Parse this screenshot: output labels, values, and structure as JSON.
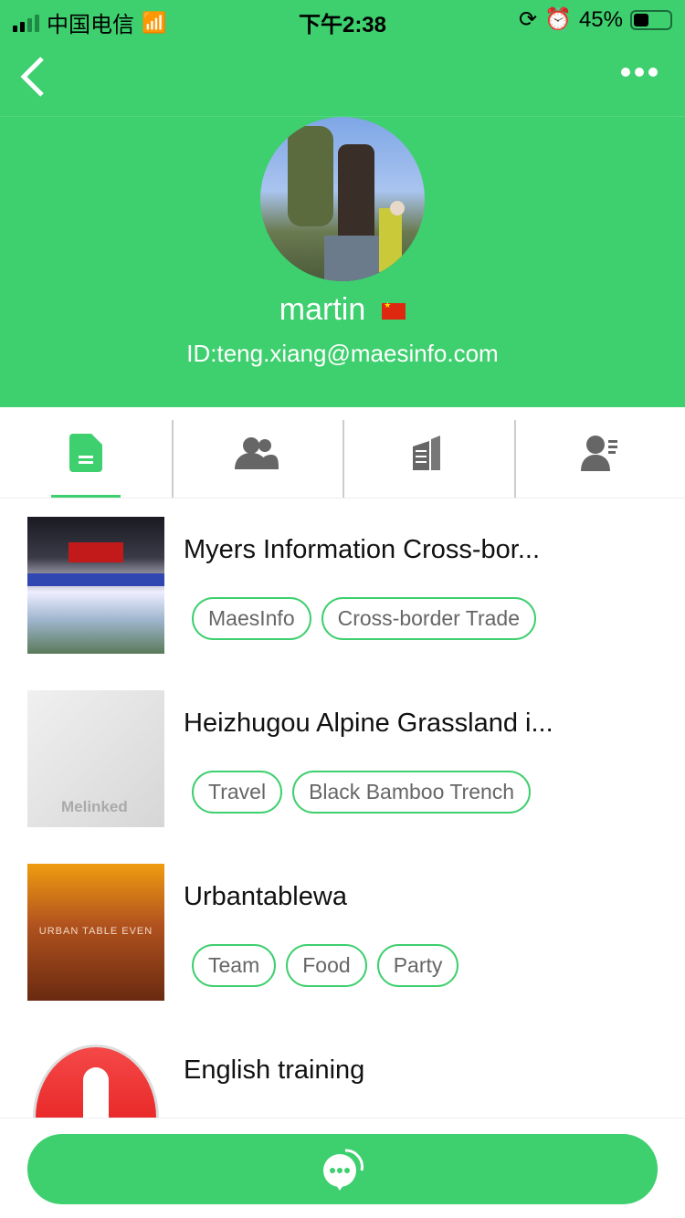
{
  "status_bar": {
    "carrier": "中国电信",
    "time": "下午2:38",
    "battery": "45%"
  },
  "profile": {
    "name": "martin",
    "id": "ID:teng.xiang@maesinfo.com",
    "country_flag": "china-flag"
  },
  "tabs": [
    {
      "icon": "document-icon",
      "active": true
    },
    {
      "icon": "contacts-icon"
    },
    {
      "icon": "building-icon"
    },
    {
      "icon": "user-card-icon"
    }
  ],
  "items": [
    {
      "title": "Myers Information Cross-bor...",
      "tags": [
        "MaesInfo",
        "Cross-border Trade"
      ]
    },
    {
      "title": "Heizhugou Alpine Grassland i...",
      "tags": [
        "Travel",
        "Black Bamboo Trench"
      ],
      "thumb_text": "Melinked"
    },
    {
      "title": "Urbantablewa",
      "tags": [
        "Team",
        "Food",
        "Party"
      ],
      "thumb_text": "URBAN TABLE EVEN"
    },
    {
      "title": "English training",
      "tags": [
        "",
        ""
      ]
    }
  ],
  "colors": {
    "accent": "#3ecf6e"
  }
}
